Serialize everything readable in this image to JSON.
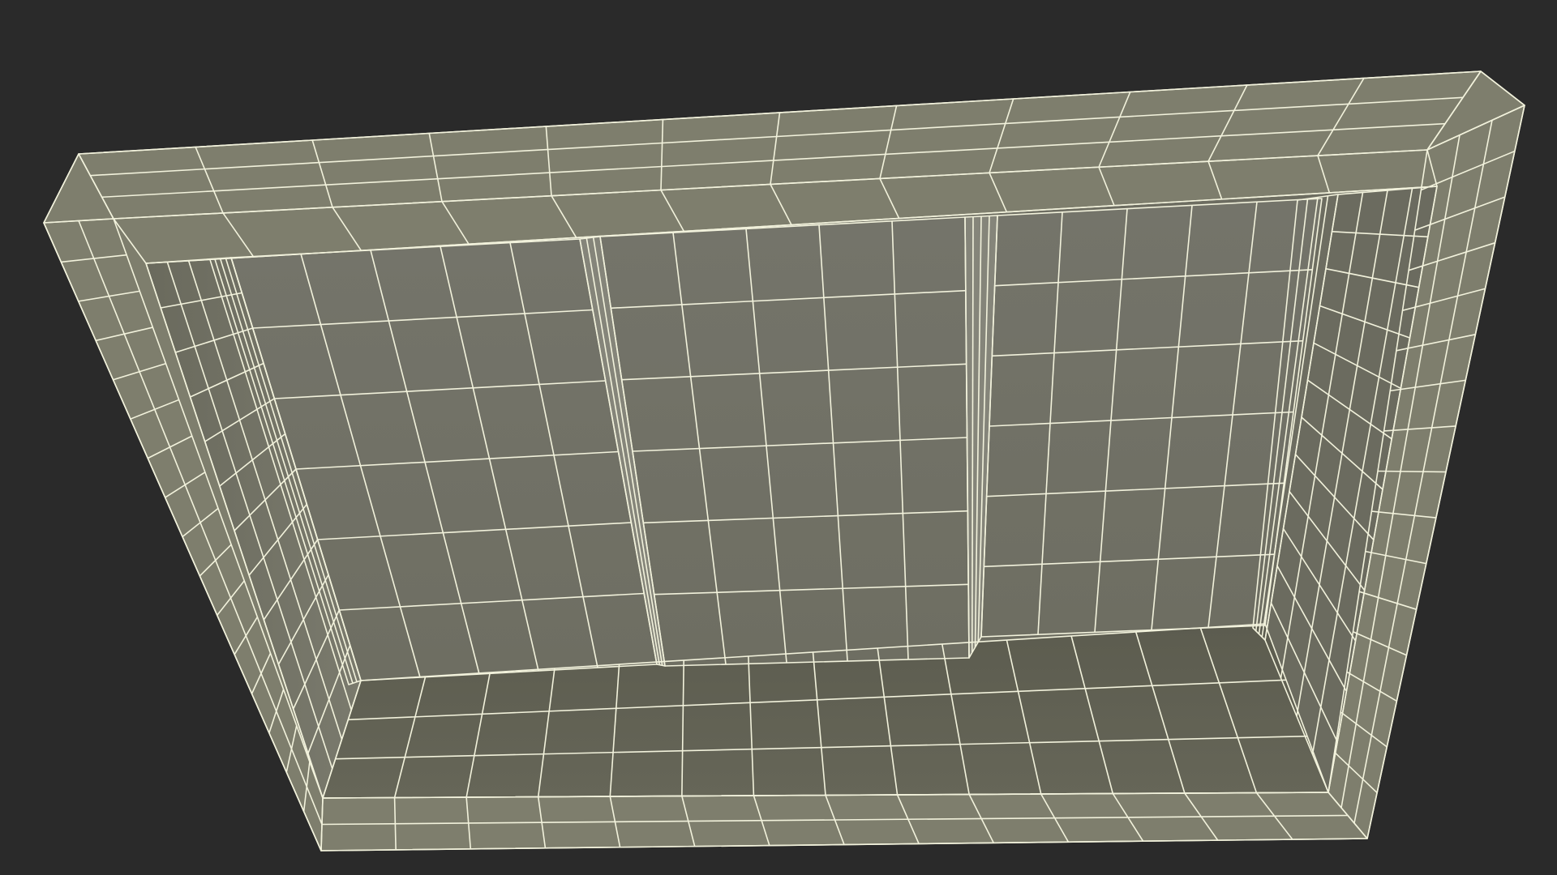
{
  "scene": {
    "subject": "wireframe-window-frame-model",
    "colors": {
      "background": "#2a2a2a",
      "frame_face": "#7f7f6e",
      "frame_shade": "#6c6c5c",
      "inner_wall": "#75756a",
      "inner_wall_dark": "#5f5f52",
      "panel": "#77776b",
      "panel_dark": "#6a6a5e",
      "sill": "#626254",
      "wire": "#f2f2dc"
    }
  }
}
